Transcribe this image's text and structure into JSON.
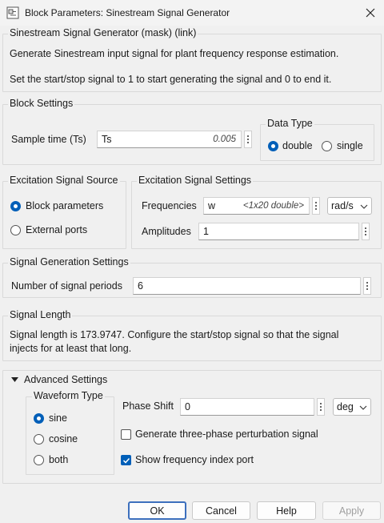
{
  "window": {
    "title": "Block Parameters: Sinestream Signal Generator"
  },
  "header": {
    "mask_title": "Sinestream Signal Generator (mask) (link)",
    "description_1": "Generate Sinestream input signal for plant frequency response estimation.",
    "description_2": "Set the start/stop signal to 1 to start generating the signal and 0 to end it."
  },
  "block_settings": {
    "legend": "Block Settings",
    "sample_time_label": "Sample time (Ts)",
    "sample_time_value": "Ts",
    "sample_time_hint": "0.005",
    "data_type": {
      "legend": "Data Type",
      "options": [
        "double",
        "single"
      ],
      "selected": "double"
    }
  },
  "excitation_source": {
    "legend": "Excitation Signal Source",
    "options": [
      "Block parameters",
      "External ports"
    ],
    "selected": "Block parameters"
  },
  "excitation_settings": {
    "legend": "Excitation Signal Settings",
    "frequencies_label": "Frequencies",
    "frequencies_value": "w",
    "frequencies_hint": "<1x20 double>",
    "frequency_unit": "rad/s",
    "amplitudes_label": "Amplitudes",
    "amplitudes_value": "1"
  },
  "signal_generation": {
    "legend": "Signal Generation Settings",
    "periods_label": "Number of signal periods",
    "periods_value": "6"
  },
  "signal_length": {
    "legend": "Signal Length",
    "text_1": "Signal length is 173.9747. Configure the start/stop signal so that the signal",
    "text_2": "injects for at least that long."
  },
  "advanced": {
    "label": "Advanced Settings",
    "expanded": true,
    "waveform": {
      "legend": "Waveform Type",
      "options": [
        "sine",
        "cosine",
        "both"
      ],
      "selected": "sine"
    },
    "phase_shift_label": "Phase Shift",
    "phase_shift_value": "0",
    "phase_unit": "deg",
    "three_phase_label": "Generate three-phase perturbation signal",
    "three_phase_checked": false,
    "freq_index_label": "Show frequency index port",
    "freq_index_checked": true
  },
  "buttons": {
    "ok": "OK",
    "cancel": "Cancel",
    "help": "Help",
    "apply": "Apply"
  },
  "colors": {
    "accent": "#005fb8",
    "background": "#f0f0f0"
  }
}
